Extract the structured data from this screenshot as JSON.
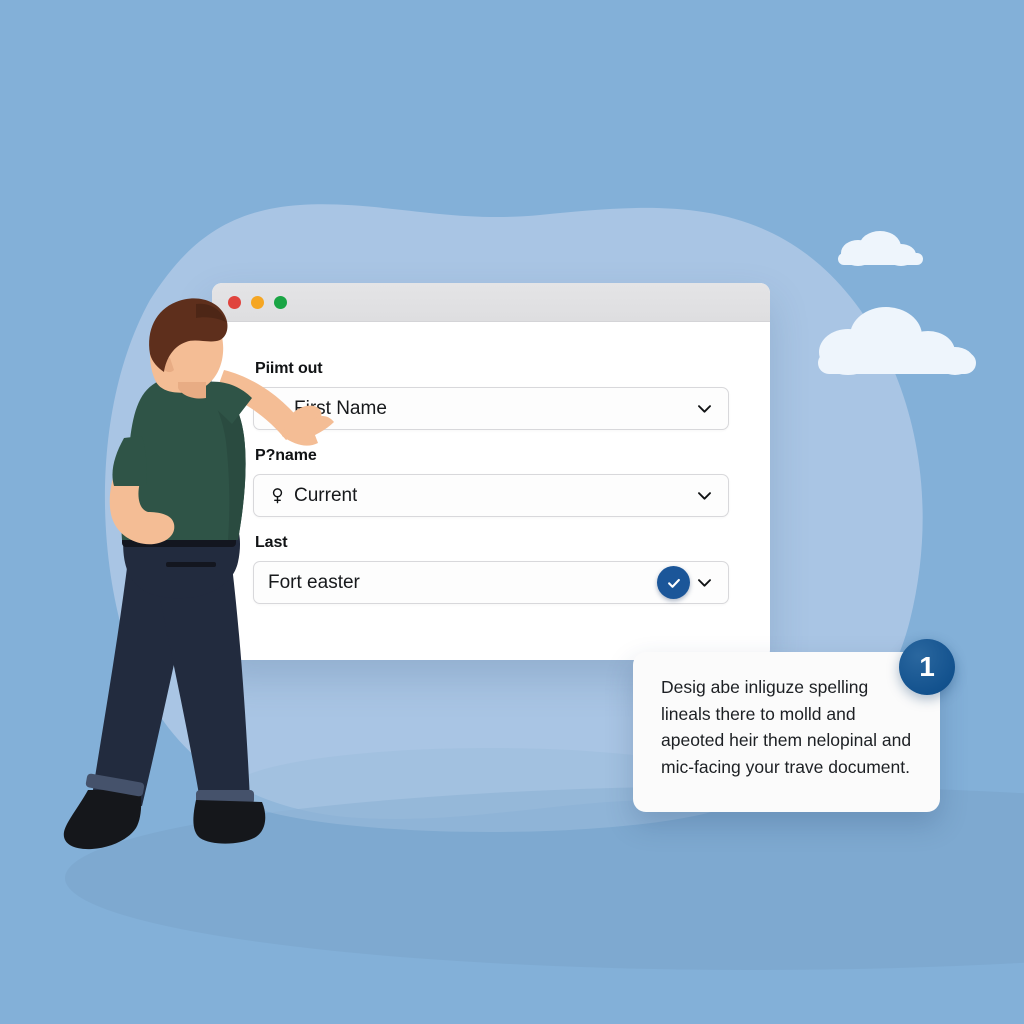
{
  "scene": {
    "title": "Form filling illustration",
    "background_color": "#83b0d8",
    "blob_color": "#a9c5e4",
    "ground_shadow_color": "#7ba4cb",
    "cloud_color": "#eef5fc"
  },
  "window": {
    "traffic_lights": [
      {
        "name": "close",
        "color": "#e0443e"
      },
      {
        "name": "minimize",
        "color": "#f5a623"
      },
      {
        "name": "maximize",
        "color": "#1aa545"
      }
    ],
    "fields": [
      {
        "label": "Piimt out",
        "value": "First Name",
        "icon": "clock-icon",
        "has_chevron": true,
        "has_check_badge": false
      },
      {
        "label": "P?name",
        "value": "Current",
        "icon": "venus-icon",
        "has_chevron": true,
        "has_check_badge": false
      },
      {
        "label": "Last",
        "value": "Fort easter",
        "icon": "none",
        "has_chevron": true,
        "has_check_badge": true
      }
    ]
  },
  "callout": {
    "text": "Desig abe inliguze spelling lineals there to molld and apeoted heir them nelopinal and mic-facing your trave document.",
    "badge_number": "1",
    "badge_color": "#13528e",
    "background_color": "#fbfbfb"
  },
  "person": {
    "description": "man pointing at form",
    "shirt_color": "#2f5447",
    "trousers_color": "#222b3e",
    "skin_color": "#f4bd95",
    "hair_color": "#5e2f1c",
    "shoe_color": "#15171b"
  }
}
